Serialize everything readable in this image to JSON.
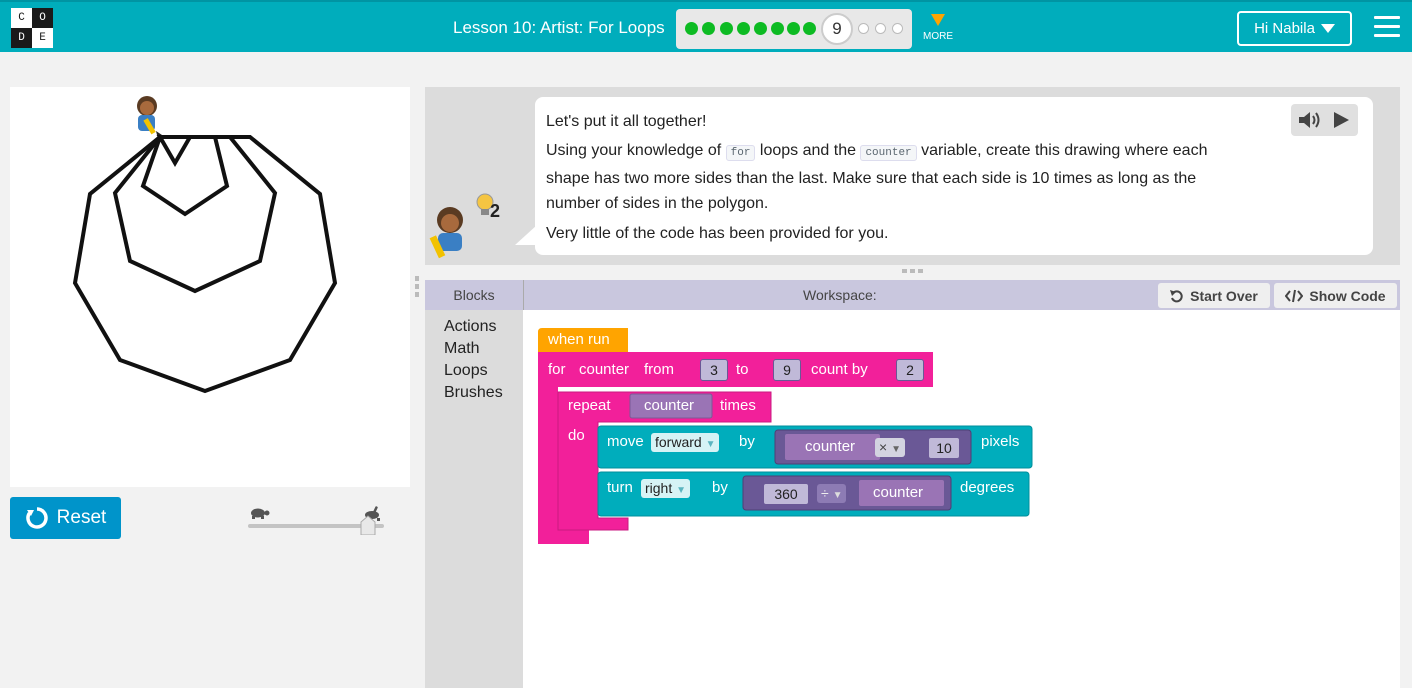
{
  "header": {
    "logo_letters": [
      "C",
      "O",
      "D",
      "E"
    ],
    "lesson_title": "Lesson 10: Artist: For Loops",
    "progress": {
      "completed_levels": 8,
      "current_level": "9",
      "remaining_levels": 3
    },
    "more_label": "MORE",
    "user_greeting": "Hi Nabila",
    "colors": {
      "bar": "#00adbc",
      "done": "#0dbb23",
      "more_arrow": "#ffa400"
    }
  },
  "play_area": {
    "reset_label": "Reset",
    "speed_slider": {
      "value_fraction": 1.0,
      "slow_icon": "turtle-icon",
      "fast_icon": "rabbit-icon"
    },
    "drawing": {
      "shapes": [
        "triangle",
        "pentagon",
        "heptagon",
        "nonagon"
      ]
    }
  },
  "instructions": {
    "hint_count": "2",
    "line1": "Let's put it all together!",
    "line2_a": "Using your knowledge of ",
    "line2_code1": "for",
    "line2_b": " loops and the ",
    "line2_code2": "counter",
    "line2_c": " variable, create this drawing where each",
    "line3": "shape has two more sides than the last. Make sure that each side is 10 times as long as the",
    "line4": "number of sides in the polygon.",
    "line5": "Very little of the code has been provided for you."
  },
  "workspace": {
    "blocks_tab": "Blocks",
    "title": "Workspace:",
    "start_over": "Start Over",
    "show_code": "Show Code",
    "categories": [
      "Actions",
      "Math",
      "Loops",
      "Brushes"
    ],
    "code": {
      "when_run": "when run",
      "for_label": "for",
      "for_var": "counter",
      "from_label": "from",
      "from_val": "3",
      "to_label": "to",
      "to_val": "9",
      "count_by_label": "count by",
      "count_by_val": "2",
      "repeat_label": "repeat",
      "repeat_var": "counter",
      "times_label": "times",
      "do_label": "do",
      "move_label": "move",
      "move_dir": "forward",
      "by_label": "by",
      "move_var": "counter",
      "mult_op": "×",
      "mult_val": "10",
      "pixels_label": "pixels",
      "turn_label": "turn",
      "turn_dir": "right",
      "turn_by_label": "by",
      "div_val": "360",
      "div_op": "÷",
      "turn_var": "counter",
      "degrees_label": "degrees"
    },
    "colors": {
      "event": "#ffa400",
      "loop": "#f2209a",
      "action": "#00adbc",
      "math": "#6a5896"
    }
  }
}
